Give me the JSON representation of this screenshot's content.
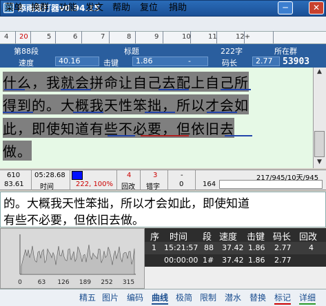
{
  "window": {
    "title": "添雨跟打器v0.94.15",
    "minimize_icon": "minimize-icon",
    "close_icon": "close-icon"
  },
  "menu": [
    "菜单",
    "换群",
    "功能",
    "发文",
    "帮助",
    "复位",
    "捐助"
  ],
  "ruler": [
    {
      "label": "4",
      "red": false
    },
    {
      "label": "20",
      "red": true
    },
    {
      "label": "5",
      "red": false
    },
    {
      "label": "6",
      "red": false
    },
    {
      "label": "7",
      "red": false
    },
    {
      "label": "8",
      "red": false
    },
    {
      "label": "9",
      "red": false
    },
    {
      "label": "10",
      "red": false
    },
    {
      "label": "11",
      "red": false
    },
    {
      "label": "12+",
      "red": false
    }
  ],
  "info": {
    "segment": "第88段",
    "title_label": "标题",
    "char_count": "222字",
    "group_label": "所在群",
    "speed_label": "速度",
    "speed": "40.16",
    "keystroke_label": "击键",
    "keystroke": "1.86",
    "dash": "-",
    "code_label": "码长",
    "code_len": "2.77",
    "total": "53903"
  },
  "text_lines": [
    "什么，我就会拼命让自己去配上自己所",
    "得到的。大概我天性笨拙，所以才会如",
    "此，即使知道有些不必要，但依旧去",
    "做。"
  ],
  "stats": {
    "v1": "610",
    "v2": "83.61",
    "time": "05:28.68",
    "time_label": "时间",
    "pct": "222, 100%",
    "back": "4",
    "back_label": "回改",
    "err": "3",
    "err_label": "错字",
    "z1": "0",
    "z2": "-",
    "n164": "164",
    "progress": "217/945/10天/945"
  },
  "typed_lines": [
    "的。大概我天性笨拙，所以才会如此，即使知道",
    "有些不必要，但依旧去做。"
  ],
  "chart_data": {
    "type": "area",
    "x_ticks": [
      "0",
      "63",
      "126",
      "189",
      "252",
      "315"
    ],
    "xlim": [
      0,
      330
    ],
    "note": "speed trace"
  },
  "table": {
    "headers": [
      "序",
      "时间",
      "段",
      "速度",
      "击键",
      "码长",
      "回改"
    ],
    "rows": [
      [
        "1",
        "15:21:57",
        "88",
        "37.42",
        "1.86",
        "2.77",
        "4"
      ],
      [
        "",
        "00:00:00",
        "1#",
        "37.42",
        "1.86",
        "2.77",
        ""
      ]
    ]
  },
  "tabs": [
    "精五",
    "图片",
    "编码",
    "曲线",
    "极简",
    "限制",
    "潜水",
    "替换",
    "标记",
    "详细"
  ],
  "active_tab": "曲线"
}
